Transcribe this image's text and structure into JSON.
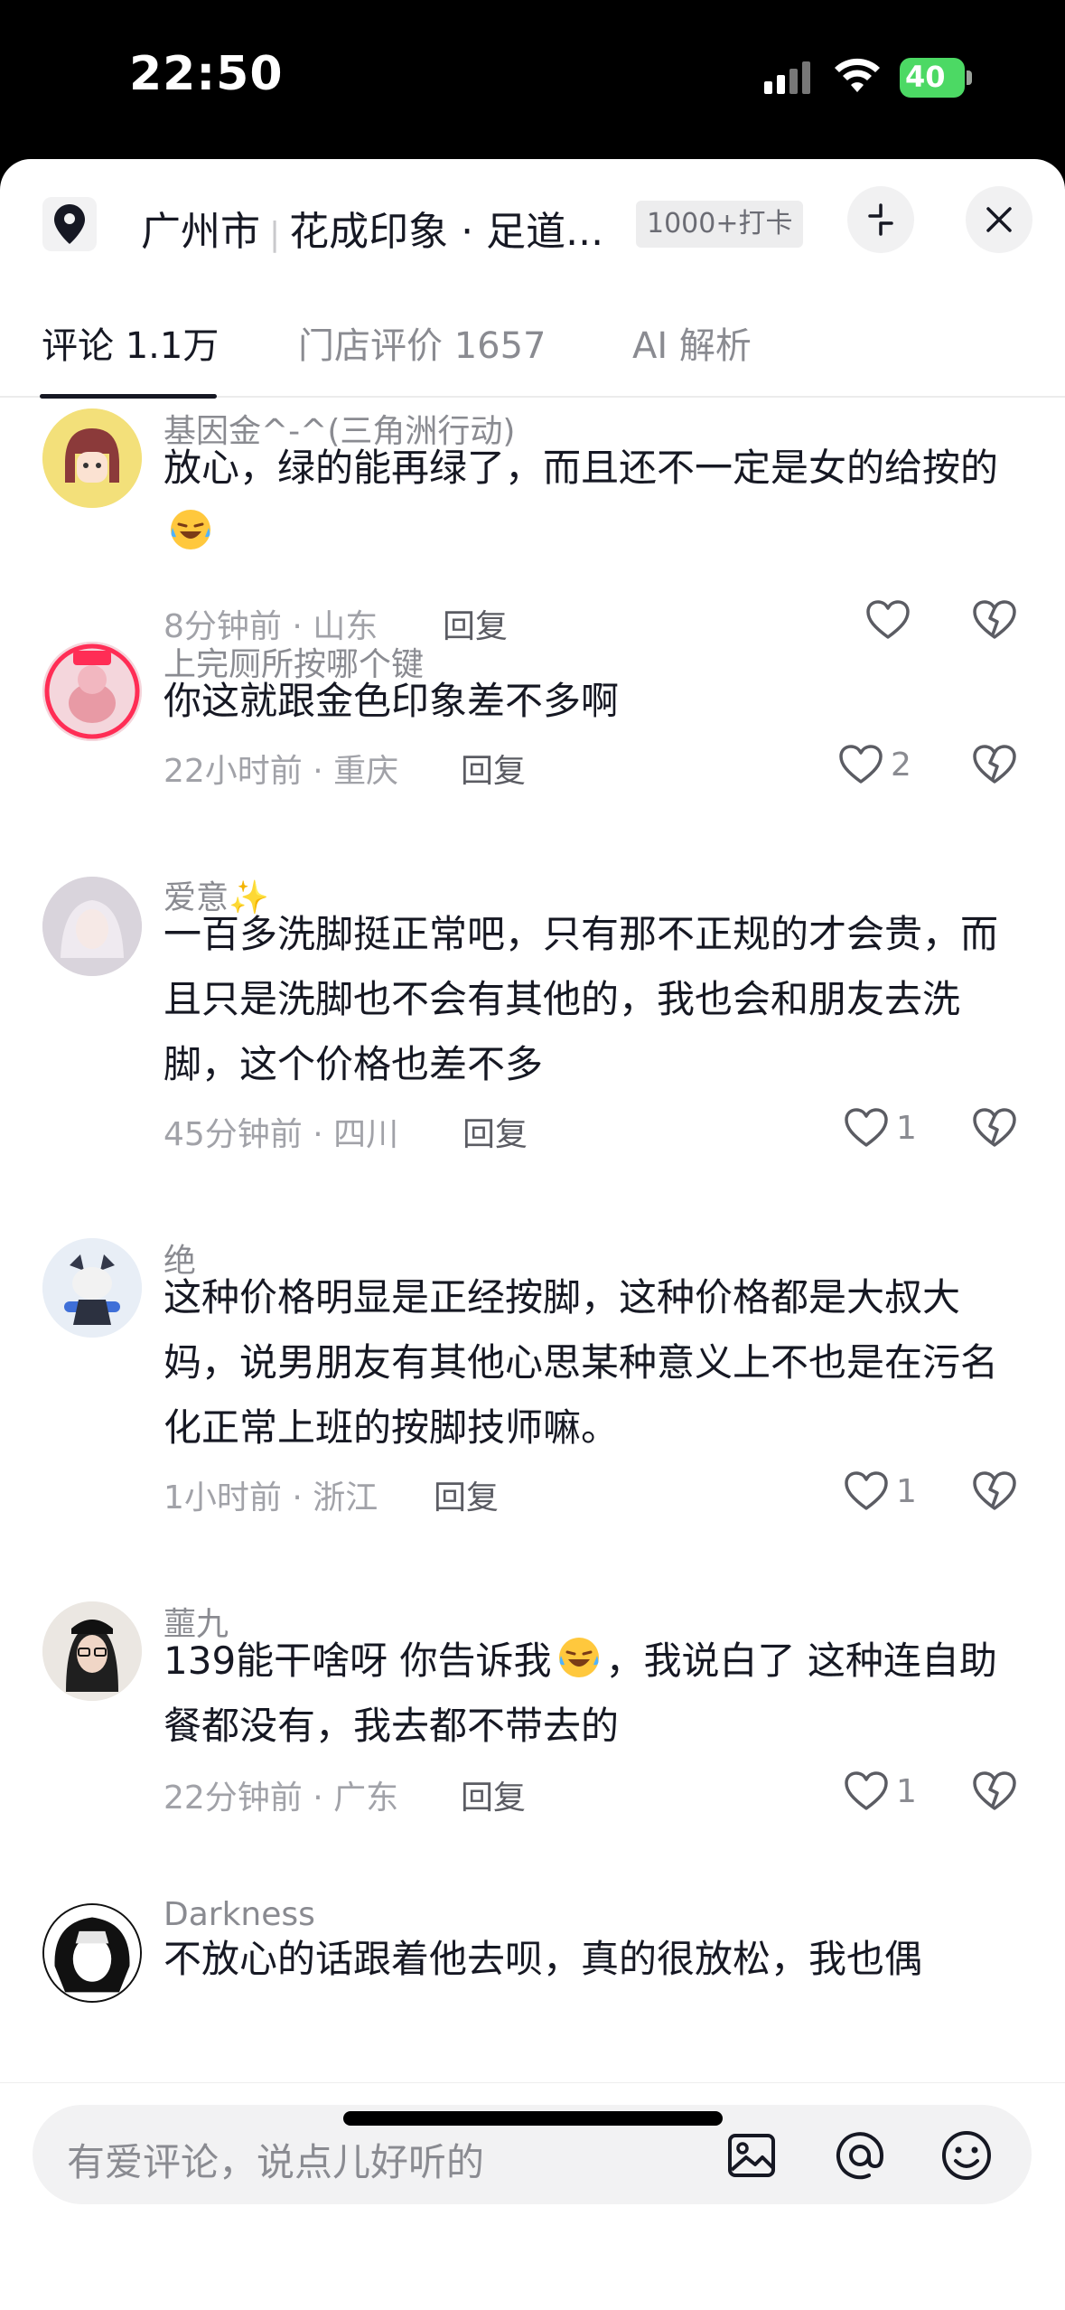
{
  "status_bar": {
    "time": "22:50",
    "battery": "40"
  },
  "header": {
    "location": "广州市",
    "shop_name": "花成印象 · 足道...",
    "checkin_badge": "1000+打卡"
  },
  "tabs": [
    {
      "label": "评论 1.1万",
      "active": true
    },
    {
      "label": "门店评价 1657",
      "active": false
    },
    {
      "label": "AI 解析",
      "active": false
    }
  ],
  "comments": [
    {
      "username": "基因金^-^(三角洲行动)",
      "text_before": "放心，绿的能再绿了，而且还不一定是女的给按的",
      "emoji": "laughing-crying-emoji",
      "text_after": "",
      "meta": "8分钟前 · 山东",
      "reply": "回复",
      "likes": ""
    },
    {
      "username": "上完厕所按哪个键",
      "text_before": "你这就跟金色印象差不多啊",
      "emoji": "",
      "text_after": "",
      "meta": "22小时前 · 重庆",
      "reply": "回复",
      "likes": "2"
    },
    {
      "username": "爱意✨",
      "text_before": "一百多洗脚挺正常吧，只有那不正规的才会贵，而且只是洗脚也不会有其他的，我也会和朋友去洗脚，这个价格也差不多",
      "emoji": "",
      "text_after": "",
      "meta": "45分钟前 · 四川",
      "reply": "回复",
      "likes": "1"
    },
    {
      "username": "绝",
      "text_before": "这种价格明显是正经按脚，这种价格都是大叔大妈，说男朋友有其他心思某种意义上不也是在污名化正常上班的按脚技师嘛。",
      "emoji": "",
      "text_after": "",
      "meta": "1小时前 · 浙江",
      "reply": "回复",
      "likes": "1"
    },
    {
      "username": "蘁九",
      "text_before": "139能干啥呀 你告诉我",
      "emoji": "laughing-crying-emoji",
      "text_after": "，我说白了 这种连自助餐都没有，我去都不带去的",
      "meta": "22分钟前 · 广东",
      "reply": "回复",
      "likes": "1"
    },
    {
      "username": "Darkness",
      "text_before": "不放心的话跟着他去呗，真的很放松，我也偶",
      "emoji": "",
      "text_after": "",
      "meta": "",
      "reply": "",
      "likes": ""
    }
  ],
  "input_bar": {
    "placeholder": "有爱评论，说点儿好听的"
  }
}
